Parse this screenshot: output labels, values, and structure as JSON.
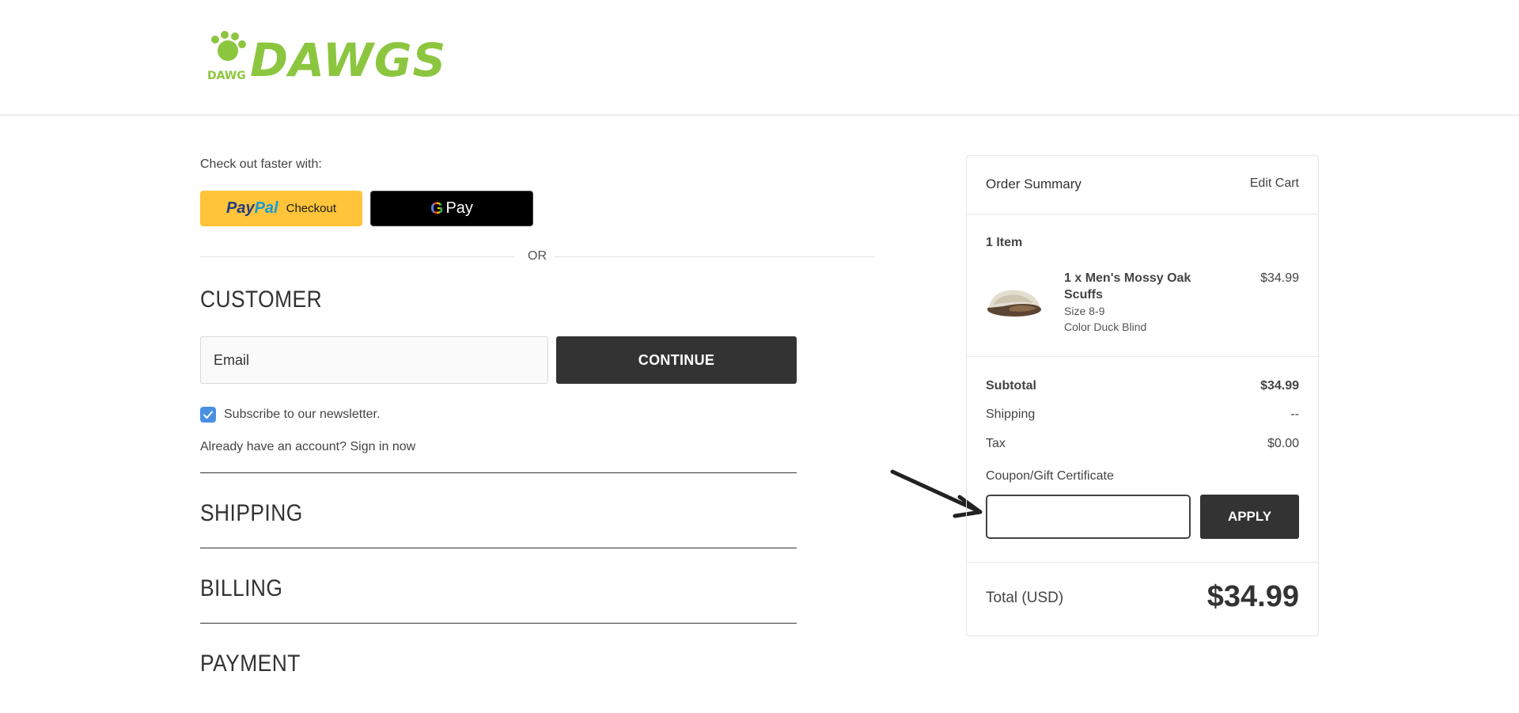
{
  "header": {
    "logo_text": "DAWGS",
    "logo_paw_text": "DAWG"
  },
  "express": {
    "label": "Check out faster with:",
    "paypal_part1": "Pay",
    "paypal_part2": "Pal",
    "paypal_checkout": "Checkout",
    "gpay_g": "G",
    "gpay_label": "Pay",
    "or_text": "OR"
  },
  "customer": {
    "title": "CUSTOMER",
    "email_placeholder": "Email",
    "continue_label": "CONTINUE",
    "newsletter_label": "Subscribe to our newsletter.",
    "newsletter_checked": true,
    "account_prompt": "Already have an account?",
    "signin_label": "Sign in now"
  },
  "steps": {
    "shipping": "SHIPPING",
    "billing": "BILLING",
    "payment": "PAYMENT"
  },
  "summary": {
    "title": "Order Summary",
    "edit_cart": "Edit Cart",
    "item_count": "1 Item",
    "item": {
      "name": "1 x Men's Mossy Oak Scuffs",
      "size": "Size 8-9",
      "color": "Color Duck Blind",
      "price": "$34.99"
    },
    "subtotal_label": "Subtotal",
    "subtotal_value": "$34.99",
    "shipping_label": "Shipping",
    "shipping_value": "--",
    "tax_label": "Tax",
    "tax_value": "$0.00",
    "coupon_label": "Coupon/Gift Certificate",
    "coupon_value": "",
    "apply_label": "APPLY",
    "total_label": "Total (USD)",
    "total_value": "$34.99"
  },
  "colors": {
    "brand_green": "#8cc63f",
    "paypal_yellow": "#ffc439",
    "dark_button": "#333333",
    "checkbox_blue": "#4a90e2"
  }
}
